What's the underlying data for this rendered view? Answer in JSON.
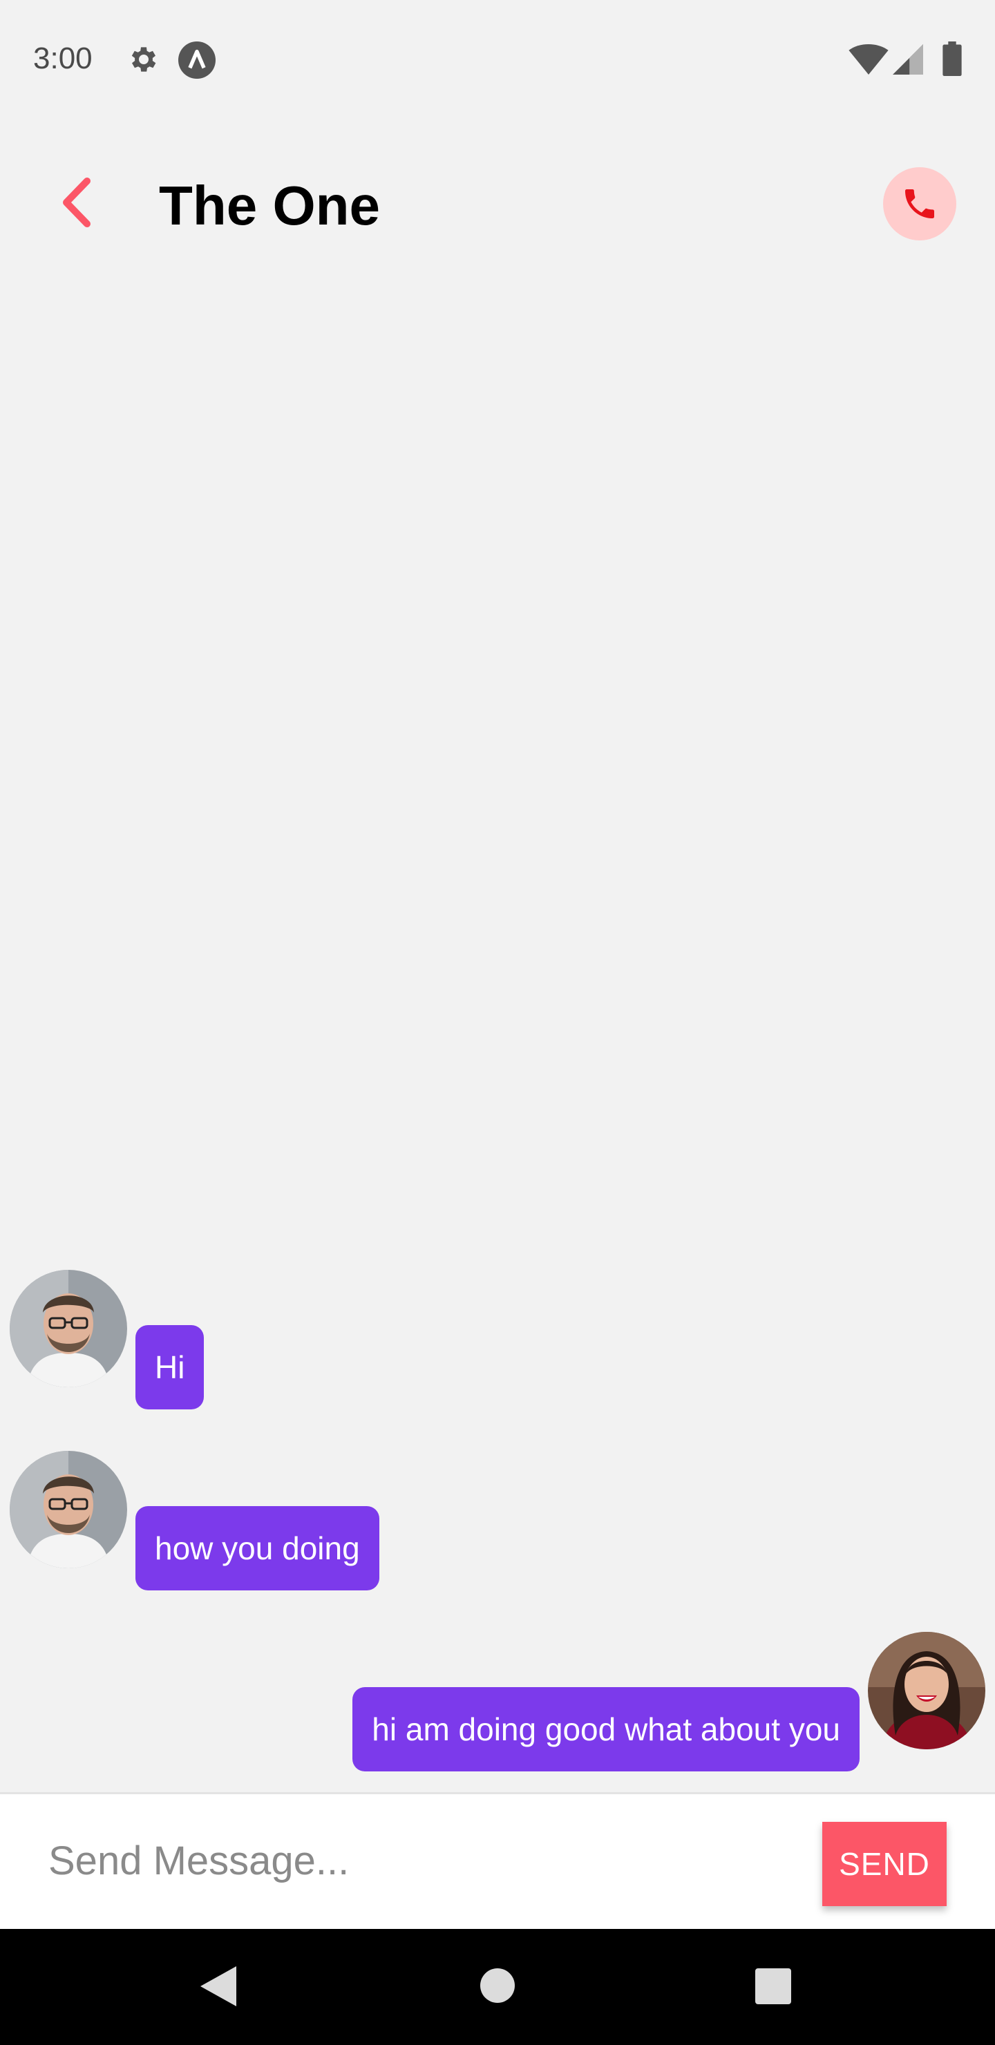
{
  "status_bar": {
    "time": "3:00",
    "icons": [
      "gear-icon",
      "a-icon",
      "wifi-icon",
      "signal-icon",
      "battery-icon"
    ]
  },
  "header": {
    "title": "The One",
    "back_icon": "chevron-left-icon",
    "call_icon": "phone-icon"
  },
  "messages": [
    {
      "sender": "contact",
      "text": "Hi"
    },
    {
      "sender": "contact",
      "text": "how you doing"
    },
    {
      "sender": "me",
      "text": "hi am doing good what about you"
    }
  ],
  "composer": {
    "placeholder": "Send Message...",
    "value": "",
    "send_label": "SEND"
  },
  "colors": {
    "accent": "#fc5667",
    "bubble": "#7c3aeb",
    "call_bg": "#ffcccc",
    "call_icon": "#e8141c",
    "background": "#f2f2f2"
  }
}
